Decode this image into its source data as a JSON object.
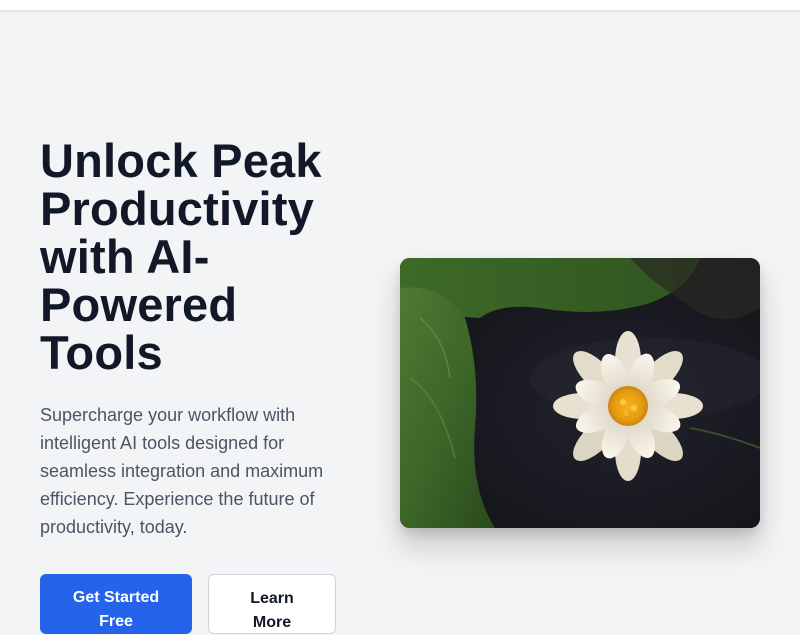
{
  "hero": {
    "title": "Unlock Peak Productivity with AI-Powered Tools",
    "description": "Supercharge your workflow with intelligent AI tools designed for seamless integration and maximum efficiency. Experience the future of productivity, today.",
    "primary_button": "Get Started Free",
    "secondary_button": "Learn More",
    "image_subject": "white water lily on dark pond with lily pads"
  },
  "colors": {
    "background": "#f3f4f6",
    "heading": "#111827",
    "body_text": "#4b5563",
    "primary": "#2563eb",
    "secondary_border": "#d1d5db"
  }
}
